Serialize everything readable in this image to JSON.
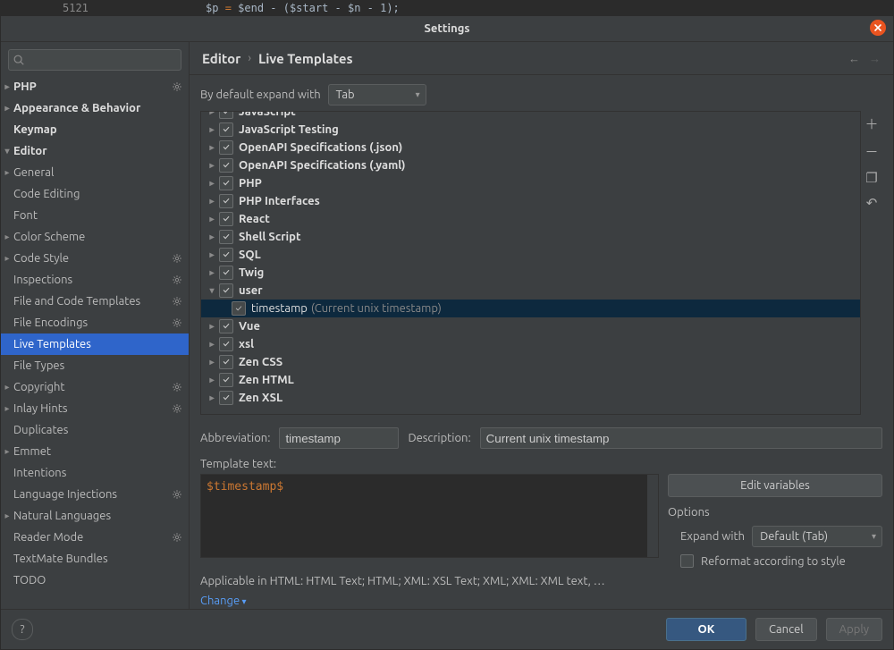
{
  "window": {
    "title": "Settings"
  },
  "code_behind": {
    "line": "5121",
    "code_prefix": "$p ",
    "code_eq": "=",
    "code_rest": " $end - ($start - $n - 1);"
  },
  "breadcrumbs": {
    "first": "Editor",
    "second": "Live Templates"
  },
  "expand": {
    "label": "By default expand with",
    "value": "Tab"
  },
  "sidebar": [
    {
      "label": "PHP",
      "ind": 0,
      "arrow": ">",
      "bold": true,
      "gear": true
    },
    {
      "label": "Appearance & Behavior",
      "ind": 0,
      "arrow": ">",
      "bold": true
    },
    {
      "label": "Keymap",
      "ind": 0,
      "arrow": "",
      "bold": true
    },
    {
      "label": "Editor",
      "ind": 0,
      "arrow": "v",
      "bold": true
    },
    {
      "label": "General",
      "ind": 1,
      "arrow": ">",
      "bold": false
    },
    {
      "label": "Code Editing",
      "ind": 1,
      "arrow": "",
      "bold": false
    },
    {
      "label": "Font",
      "ind": 1,
      "arrow": "",
      "bold": false
    },
    {
      "label": "Color Scheme",
      "ind": 1,
      "arrow": ">",
      "bold": false
    },
    {
      "label": "Code Style",
      "ind": 1,
      "arrow": ">",
      "bold": false,
      "gear": true
    },
    {
      "label": "Inspections",
      "ind": 1,
      "arrow": "",
      "bold": false,
      "gear": true
    },
    {
      "label": "File and Code Templates",
      "ind": 1,
      "arrow": "",
      "bold": false,
      "gear": true
    },
    {
      "label": "File Encodings",
      "ind": 1,
      "arrow": "",
      "bold": false,
      "gear": true
    },
    {
      "label": "Live Templates",
      "ind": 1,
      "arrow": "",
      "bold": false,
      "sel": true
    },
    {
      "label": "File Types",
      "ind": 1,
      "arrow": "",
      "bold": false
    },
    {
      "label": "Copyright",
      "ind": 1,
      "arrow": ">",
      "bold": false,
      "gear": true
    },
    {
      "label": "Inlay Hints",
      "ind": 1,
      "arrow": ">",
      "bold": false,
      "gear": true
    },
    {
      "label": "Duplicates",
      "ind": 1,
      "arrow": "",
      "bold": false
    },
    {
      "label": "Emmet",
      "ind": 1,
      "arrow": ">",
      "bold": false
    },
    {
      "label": "Intentions",
      "ind": 1,
      "arrow": "",
      "bold": false
    },
    {
      "label": "Language Injections",
      "ind": 1,
      "arrow": "",
      "bold": false,
      "gear": true
    },
    {
      "label": "Natural Languages",
      "ind": 1,
      "arrow": ">",
      "bold": false
    },
    {
      "label": "Reader Mode",
      "ind": 1,
      "arrow": "",
      "bold": false,
      "gear": true
    },
    {
      "label": "TextMate Bundles",
      "ind": 1,
      "arrow": "",
      "bold": false
    },
    {
      "label": "TODO",
      "ind": 1,
      "arrow": "",
      "bold": false
    }
  ],
  "groups": [
    {
      "label": "JavaScript",
      "arrow": ">",
      "checked": true,
      "cut": true
    },
    {
      "label": "JavaScript Testing",
      "arrow": ">",
      "checked": true
    },
    {
      "label": "OpenAPI Specifications (.json)",
      "arrow": ">",
      "checked": true
    },
    {
      "label": "OpenAPI Specifications (.yaml)",
      "arrow": ">",
      "checked": true
    },
    {
      "label": "PHP",
      "arrow": ">",
      "checked": true
    },
    {
      "label": "PHP Interfaces",
      "arrow": ">",
      "checked": true
    },
    {
      "label": "React",
      "arrow": ">",
      "checked": true
    },
    {
      "label": "Shell Script",
      "arrow": ">",
      "checked": true
    },
    {
      "label": "SQL",
      "arrow": ">",
      "checked": true
    },
    {
      "label": "Twig",
      "arrow": ">",
      "checked": true
    },
    {
      "label": "user",
      "arrow": "v",
      "checked": true,
      "expanded": true,
      "children": [
        {
          "name": "timestamp",
          "desc": "(Current unix timestamp)",
          "checked": true,
          "sel": true
        }
      ]
    },
    {
      "label": "Vue",
      "arrow": ">",
      "checked": true
    },
    {
      "label": "xsl",
      "arrow": ">",
      "checked": true
    },
    {
      "label": "Zen CSS",
      "arrow": ">",
      "checked": true
    },
    {
      "label": "Zen HTML",
      "arrow": ">",
      "checked": true
    },
    {
      "label": "Zen XSL",
      "arrow": ">",
      "checked": true
    }
  ],
  "form": {
    "abbrev_label": "Abbreviation:",
    "abbrev_value": "timestamp",
    "desc_label": "Description:",
    "desc_value": "Current unix timestamp",
    "tpl_label": "Template text:",
    "tpl_text": "$timestamp$",
    "editvars": "Edit variables",
    "options_label": "Options",
    "expand_with_label": "Expand with",
    "expand_with_value": "Default (Tab)",
    "reformat_label": "Reformat according to style",
    "applicable": "Applicable in HTML: HTML Text; HTML; XML: XSL Text; XML; XML: XML text, …",
    "change": "Change"
  },
  "buttons": {
    "ok": "OK",
    "cancel": "Cancel",
    "apply": "Apply",
    "help": "?"
  }
}
